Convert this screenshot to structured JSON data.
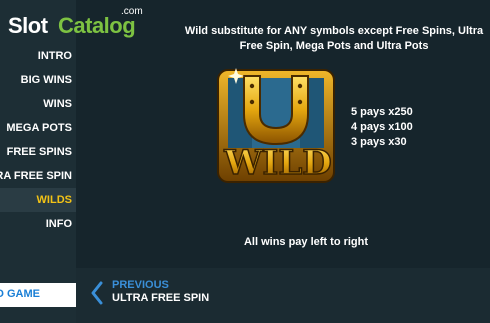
{
  "logo": {
    "slot": "Slot",
    "catalog": "Catalog",
    "com": ".com"
  },
  "menu": {
    "items": [
      {
        "label": "INTRO"
      },
      {
        "label": "BIG WINS"
      },
      {
        "label": "WINS"
      },
      {
        "label": "MEGA POTS"
      },
      {
        "label": "FREE SPINS"
      },
      {
        "label": "ULTRA FREE SPIN"
      },
      {
        "label": "WILDS"
      },
      {
        "label": "INFO"
      }
    ],
    "active": "WILDS",
    "goto_label": "GO TO GAME"
  },
  "content": {
    "description": "Wild substitute for ANY symbols except Free Spins, Ultra Free Spin, Mega Pots and Ultra Pots",
    "symbol_text": "WILD",
    "pays": [
      "5 pays x250",
      "4 pays x100",
      "3 pays x30"
    ],
    "footer_note": "All wins pay left to right"
  },
  "nav": {
    "previous_label": "PREVIOUS",
    "previous_name": "ULTRA FREE SPIN"
  },
  "colors": {
    "accent": "#f3c316",
    "link": "#3a8fd8",
    "brand_green": "#7dc242"
  }
}
